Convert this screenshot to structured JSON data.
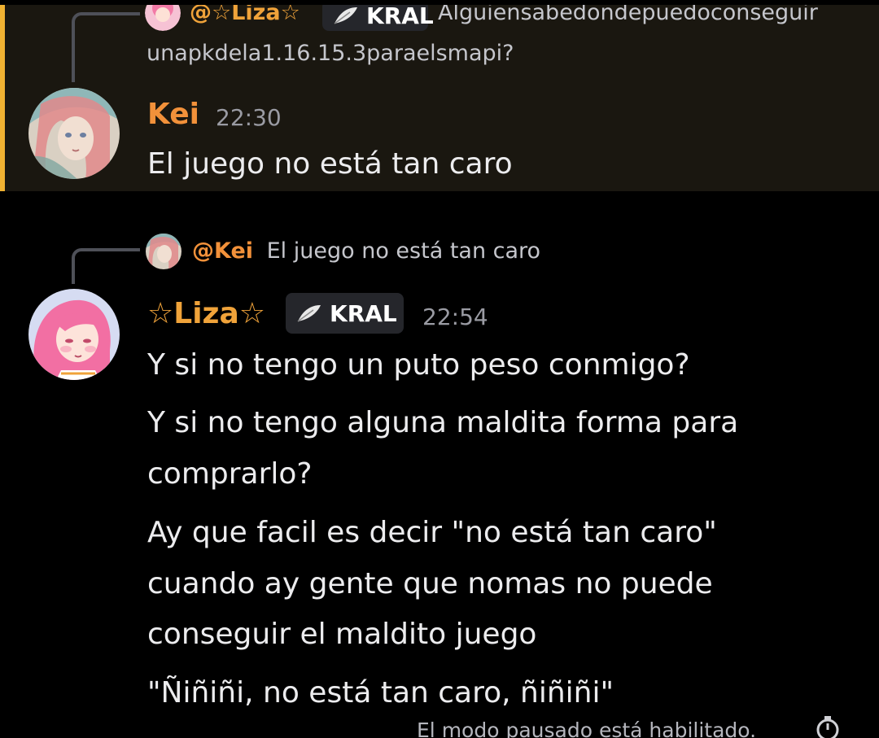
{
  "colors": {
    "background": "#000000",
    "mention_highlight": "#1a1710",
    "mention_bar": "#f0b232",
    "username_kei": "#f2913a",
    "username_liza": "#f0a33a",
    "timestamp": "#9a9ba3",
    "message_text": "#ececee"
  },
  "message1": {
    "reply": {
      "author": "@☆Liza☆",
      "tag": "KRAL",
      "tag_icon": "feather-icon",
      "content_line1": "Alguiensabedondepuedoconseguir",
      "content_line2": "unapkdela1.16.15.3paraelsmapi?"
    },
    "author": "Kei",
    "time": "22:30",
    "lines": [
      "El juego no está tan caro"
    ]
  },
  "message2": {
    "reply": {
      "author": "@Kei",
      "content": "El juego no está tan caro"
    },
    "author": "☆Liza☆",
    "tag": "KRAL",
    "tag_icon": "feather-icon",
    "time": "22:54",
    "lines": [
      "Y si no tengo un puto peso conmigo?",
      "Y si no tengo alguna maldita forma para",
      "comprarlo?",
      "Ay que facil es decir \"no está tan caro\"",
      "cuando ay gente que nomas no puede",
      "conseguir el maldito juego",
      "\"Ñiñiñi, no está tan caro, ñiñiñi\""
    ]
  },
  "footer": {
    "status": "El modo pausado está habilitado.",
    "status_icon": "timer-icon"
  }
}
